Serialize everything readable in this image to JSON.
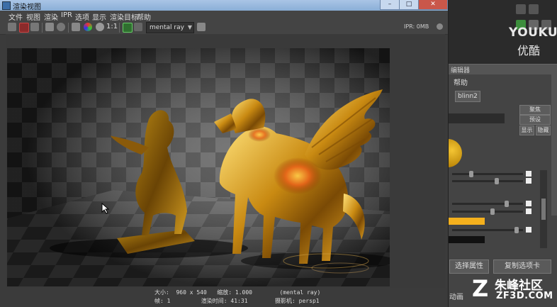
{
  "window": {
    "title": "渲染视图",
    "controls": {
      "minimize": "–",
      "maximize": "□",
      "close": "✕"
    }
  },
  "menu": [
    "文件",
    "视图",
    "渲染",
    "IPR",
    "选项",
    "显示",
    "渲染目标",
    "帮助"
  ],
  "toolbar": {
    "ratio_label": "1:1",
    "renderer": "mental ray",
    "ipr_memory": "IPR: 0MB",
    "icons": [
      "redo-render-icon",
      "ipr-render-icon",
      "render-region-icon",
      "snapshot-icon",
      "refresh-icon",
      "keep-image-icon",
      "color-channels-icon",
      "alpha-channel-icon",
      "real-size-icon",
      "display-image-icon",
      "render-settings-icon"
    ]
  },
  "status": {
    "line1": "大小:  960 x 540   缩放: 1.000        (mental ray)",
    "line2": "帧: 1         渲染时间: 41:31        摄影机: persp1"
  },
  "side_panel": {
    "watermark_top": "YOUKU",
    "watermark_top_cn": "优酷",
    "header": "编辑器",
    "help_menu": "帮助",
    "material_tab": "blinn2",
    "buttons": {
      "focus": "聚焦",
      "presets": "预设",
      "show": "显示",
      "hide": "隐藏"
    },
    "bottom_buttons": {
      "select_attr": "选择属性",
      "copy_tab": "复制选项卡"
    },
    "bottom_label": "动画",
    "watermark_bottom_cn": "朱峰社区",
    "watermark_bottom_en": "ZF3D.COM"
  }
}
